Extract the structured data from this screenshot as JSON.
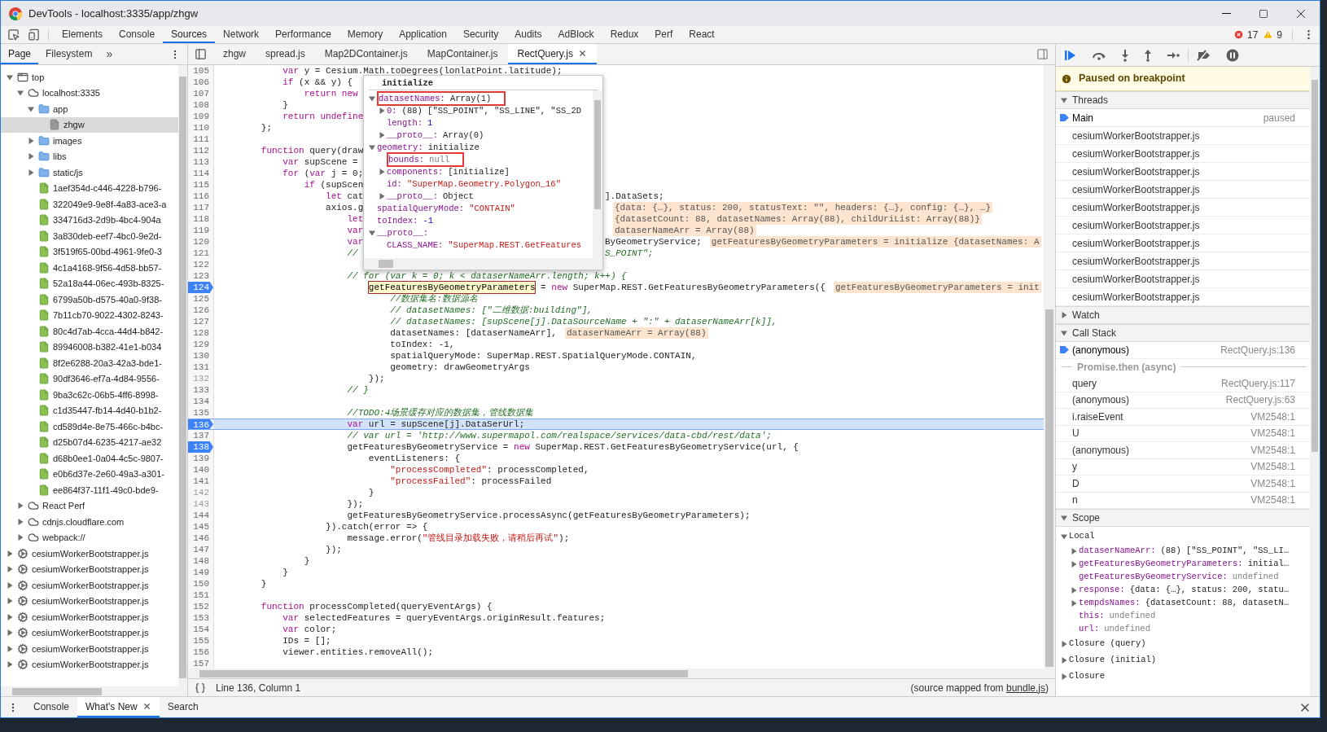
{
  "window": {
    "title": "DevTools - localhost:3335/app/zhgw"
  },
  "main_tabs": [
    {
      "label": "Elements",
      "selected": false
    },
    {
      "label": "Console",
      "selected": false
    },
    {
      "label": "Sources",
      "selected": true
    },
    {
      "label": "Network",
      "selected": false
    },
    {
      "label": "Performance",
      "selected": false
    },
    {
      "label": "Memory",
      "selected": false
    },
    {
      "label": "Application",
      "selected": false
    },
    {
      "label": "Security",
      "selected": false
    },
    {
      "label": "Audits",
      "selected": false
    },
    {
      "label": "AdBlock",
      "selected": false
    },
    {
      "label": "Redux",
      "selected": false
    },
    {
      "label": "Perf",
      "selected": false
    },
    {
      "label": "React",
      "selected": false
    }
  ],
  "issues": {
    "errors": "17",
    "warnings": "9"
  },
  "sidebar": {
    "tabs": [
      {
        "label": "Page",
        "selected": true
      },
      {
        "label": "Filesystem",
        "selected": false
      }
    ],
    "more": "»",
    "tree": [
      {
        "label": "top",
        "kind": "frame",
        "expanded": true,
        "selected": false,
        "children": [
          {
            "label": "localhost:3335",
            "kind": "domain",
            "expanded": true,
            "selected": false,
            "children": [
              {
                "label": "app",
                "kind": "folder",
                "expanded": true,
                "selected": false,
                "children": [
                  {
                    "label": "zhgw",
                    "kind": "file",
                    "selected": true
                  }
                ]
              },
              {
                "label": "images",
                "kind": "folder",
                "expanded": false,
                "selected": false
              },
              {
                "label": "libs",
                "kind": "folder",
                "expanded": false,
                "selected": false
              },
              {
                "label": "static/js",
                "kind": "folder",
                "expanded": false,
                "selected": false
              },
              {
                "label": "1aef354d-c446-4228-b796-",
                "kind": "script",
                "selected": false
              },
              {
                "label": "322049e9-9e8f-4a83-ace3-a",
                "kind": "script",
                "selected": false
              },
              {
                "label": "334716d3-2d9b-4bc4-904a",
                "kind": "script",
                "selected": false
              },
              {
                "label": "3a830deb-eef7-4bc0-9e2d-",
                "kind": "script",
                "selected": false
              },
              {
                "label": "3f519f65-00bd-4961-9fe0-3",
                "kind": "script",
                "selected": false
              },
              {
                "label": "4c1a4168-9f56-4d58-bb57-",
                "kind": "script",
                "selected": false
              },
              {
                "label": "52a18a44-06ec-493b-8325-",
                "kind": "script",
                "selected": false
              },
              {
                "label": "6799a50b-d575-40a0-9f38-",
                "kind": "script",
                "selected": false
              },
              {
                "label": "7b11cb70-9022-4302-8243-",
                "kind": "script",
                "selected": false
              },
              {
                "label": "80c4d7ab-4cca-44d4-b842-",
                "kind": "script",
                "selected": false
              },
              {
                "label": "89946008-b382-41e1-b034",
                "kind": "script",
                "selected": false
              },
              {
                "label": "8f2e6288-20a3-42a3-bde1-",
                "kind": "script",
                "selected": false
              },
              {
                "label": "90df3646-ef7a-4d84-9556-",
                "kind": "script",
                "selected": false
              },
              {
                "label": "9ba3c62c-06b5-4ff6-8998-",
                "kind": "script",
                "selected": false
              },
              {
                "label": "c1d35447-fb14-4d40-b1b2-",
                "kind": "script",
                "selected": false
              },
              {
                "label": "cd589d4e-8e75-466c-b4bc-",
                "kind": "script",
                "selected": false
              },
              {
                "label": "d25b07d4-6235-4217-ae32",
                "kind": "script",
                "selected": false
              },
              {
                "label": "d68b0ee1-0a04-4c5c-9807-",
                "kind": "script",
                "selected": false
              },
              {
                "label": "e0b6d37e-2e60-49a3-a301-",
                "kind": "script",
                "selected": false
              },
              {
                "label": "ee864f37-11f1-49c0-bde9-",
                "kind": "script",
                "selected": false
              }
            ]
          },
          {
            "label": "React Perf",
            "kind": "domain",
            "expanded": false,
            "selected": false
          },
          {
            "label": "cdnjs.cloudflare.com",
            "kind": "domain",
            "expanded": false,
            "selected": false
          },
          {
            "label": "webpack://",
            "kind": "domain",
            "expanded": false,
            "selected": false
          }
        ]
      },
      {
        "label": "cesiumWorkerBootstrapper.js",
        "kind": "worker",
        "expanded": false,
        "selected": false
      },
      {
        "label": "cesiumWorkerBootstrapper.js",
        "kind": "worker",
        "expanded": false,
        "selected": false
      },
      {
        "label": "cesiumWorkerBootstrapper.js",
        "kind": "worker",
        "expanded": false,
        "selected": false
      },
      {
        "label": "cesiumWorkerBootstrapper.js",
        "kind": "worker",
        "expanded": false,
        "selected": false
      },
      {
        "label": "cesiumWorkerBootstrapper.js",
        "kind": "worker",
        "expanded": false,
        "selected": false
      },
      {
        "label": "cesiumWorkerBootstrapper.js",
        "kind": "worker",
        "expanded": false,
        "selected": false
      },
      {
        "label": "cesiumWorkerBootstrapper.js",
        "kind": "worker",
        "expanded": false,
        "selected": false
      },
      {
        "label": "cesiumWorkerBootstrapper.js",
        "kind": "worker",
        "expanded": false,
        "selected": false
      }
    ]
  },
  "editor_tabs": [
    {
      "label": "zhgw",
      "selected": false
    },
    {
      "label": "spread.js",
      "selected": false
    },
    {
      "label": "Map2DContainer.js",
      "selected": false
    },
    {
      "label": "MapContainer.js",
      "selected": false
    },
    {
      "label": "RectQuery.js",
      "selected": true
    }
  ],
  "code": {
    "lines": [
      {
        "n": "105",
        "breakpoint": false,
        "current": false,
        "breakable": true,
        "code": [
          {
            "text": "            var",
            "kind": "kw"
          },
          {
            "text": " y = Cesium.Math.toDegrees(lonlatPoint.latitude);",
            "kind": "plain"
          }
        ]
      },
      {
        "n": "106",
        "breakpoint": false,
        "current": false,
        "breakable": true,
        "code": [
          {
            "text": "            if",
            "kind": "kw"
          },
          {
            "text": " (x && y) {",
            "kind": "plain"
          }
        ]
      },
      {
        "n": "107",
        "breakpoint": false,
        "current": false,
        "breakable": true,
        "code": [
          {
            "text": "                return new",
            "kind": "kw"
          }
        ]
      },
      {
        "n": "108",
        "breakpoint": false,
        "current": false,
        "breakable": true,
        "code": [
          {
            "text": "            }",
            "kind": "plain"
          }
        ]
      },
      {
        "n": "109",
        "breakpoint": false,
        "current": false,
        "breakable": true,
        "code": [
          {
            "text": "            return undefine",
            "kind": "kw"
          }
        ]
      },
      {
        "n": "110",
        "breakpoint": false,
        "current": false,
        "breakable": true,
        "code": [
          {
            "text": "        };",
            "kind": "plain"
          }
        ]
      },
      {
        "n": "111",
        "breakpoint": false,
        "current": false,
        "breakable": true
      },
      {
        "n": "112",
        "breakpoint": false,
        "current": false,
        "breakable": true,
        "code": [
          {
            "text": "        function",
            "kind": "kw"
          },
          {
            "text": " query(draw",
            "kind": "plain"
          }
        ]
      },
      {
        "n": "113",
        "breakpoint": false,
        "current": false,
        "breakable": true,
        "code": [
          {
            "text": "            var",
            "kind": "kw"
          },
          {
            "text": " supScene =",
            "kind": "plain"
          }
        ]
      },
      {
        "n": "114",
        "breakpoint": false,
        "current": false,
        "breakable": true,
        "code": [
          {
            "text": "            for",
            "kind": "kw"
          },
          {
            "text": " (",
            "kind": "plain"
          },
          {
            "text": "var",
            "kind": "kw"
          },
          {
            "text": " j = 0;",
            "kind": "plain"
          }
        ]
      },
      {
        "n": "115",
        "breakpoint": false,
        "current": false,
        "breakable": true,
        "code": [
          {
            "text": "                if",
            "kind": "kw"
          },
          {
            "text": " (supScen",
            "kind": "plain"
          }
        ]
      },
      {
        "n": "116",
        "breakpoint": false,
        "current": false,
        "breakable": true,
        "code": [
          {
            "text": "                    let",
            "kind": "kw"
          },
          {
            "text": " cat",
            "kind": "plain"
          }
        ],
        "after": [
          {
            "text": "].DataSets;",
            "kind": "plain"
          }
        ]
      },
      {
        "n": "117",
        "breakpoint": false,
        "current": false,
        "breakable": true,
        "code": [
          {
            "text": "                    axios.g",
            "kind": "plain"
          }
        ],
        "after": [
          {
            "text": "{data: {…}, status: 200, statusText: \"\", headers: {…}, config: {…}, …}",
            "kind": "note"
          }
        ]
      },
      {
        "n": "118",
        "breakpoint": false,
        "current": false,
        "breakable": true,
        "code": [
          {
            "text": "                        let",
            "kind": "kw"
          }
        ],
        "after": [
          {
            "text": "{datasetCount: 88, datasetNames: Array(88), childUriList: Array(88)}",
            "kind": "note"
          }
        ]
      },
      {
        "n": "119",
        "breakpoint": false,
        "current": false,
        "breakable": true,
        "code": [
          {
            "text": "                        var",
            "kind": "kw"
          }
        ],
        "after": [
          {
            "text": "dataserNameArr = Array(88)",
            "kind": "note"
          }
        ]
      },
      {
        "n": "120",
        "breakpoint": false,
        "current": false,
        "breakable": true,
        "code": [
          {
            "text": "                        var",
            "kind": "kw"
          }
        ],
        "after": [
          {
            "text": "ByGeometryService;",
            "kind": "plain"
          },
          {
            "text": "getFeaturesByGeometryParameters = initialize {datasetNames: A",
            "kind": "note"
          }
        ]
      },
      {
        "n": "121",
        "breakpoint": false,
        "current": false,
        "breakable": true,
        "code": [
          {
            "text": "                        //",
            "kind": "cmt"
          }
        ],
        "after": [
          {
            "text": "S_POINT\";",
            "kind": "cmt"
          }
        ]
      },
      {
        "n": "122",
        "breakpoint": false,
        "current": false,
        "breakable": true
      },
      {
        "n": "123",
        "breakpoint": false,
        "current": false,
        "breakable": true,
        "code": [
          {
            "text": "                        // for (var k = 0; k < dataserNameArr.length; k++) {",
            "kind": "cmt"
          }
        ]
      },
      {
        "n": "124",
        "breakpoint": true,
        "current": false,
        "breakable": true,
        "code": [
          {
            "text": "                            getFeaturesByGeometryParameters",
            "kind": "hover"
          },
          {
            "text": " = ",
            "kind": "plain"
          },
          {
            "text": "new",
            "kind": "kw"
          },
          {
            "text": " SuperMap.REST.GetFeaturesByGeometryParameters({",
            "kind": "plain"
          },
          {
            "text": "getFeaturesByGeometryParameters = init",
            "kind": "note"
          }
        ]
      },
      {
        "n": "125",
        "breakpoint": false,
        "current": false,
        "breakable": true,
        "code": [
          {
            "text": "                                //数据集名:数据源名",
            "kind": "cmt"
          }
        ]
      },
      {
        "n": "126",
        "breakpoint": false,
        "current": false,
        "breakable": true,
        "code": [
          {
            "text": "                                // datasetNames: [\"二维数据:building\"],",
            "kind": "cmt"
          }
        ]
      },
      {
        "n": "127",
        "breakpoint": false,
        "current": false,
        "breakable": true,
        "code": [
          {
            "text": "                                // datasetNames: [supScene[j].DataSourceName + \":\" + dataserNameArr[k]],",
            "kind": "cmt"
          }
        ]
      },
      {
        "n": "128",
        "breakpoint": false,
        "current": false,
        "breakable": true,
        "code": [
          {
            "text": "                                datasetNames: [dataserNameArr],",
            "kind": "plain"
          },
          {
            "text": "dataserNameArr = Array(88)",
            "kind": "note"
          }
        ]
      },
      {
        "n": "129",
        "breakpoint": false,
        "current": false,
        "breakable": true,
        "code": [
          {
            "text": "                                toIndex: -1,",
            "kind": "plain"
          }
        ]
      },
      {
        "n": "130",
        "breakpoint": false,
        "current": false,
        "breakable": true,
        "code": [
          {
            "text": "                                spatialQueryMode: SuperMap.REST.SpatialQueryMode.CONTAIN,",
            "kind": "plain"
          }
        ]
      },
      {
        "n": "131",
        "breakpoint": false,
        "current": false,
        "breakable": true,
        "code": [
          {
            "text": "                                geometry: drawGeometryArgs",
            "kind": "plain"
          }
        ]
      },
      {
        "n": "132",
        "breakpoint": false,
        "current": false,
        "breakable": false,
        "code": [
          {
            "text": "                            });",
            "kind": "plain"
          }
        ]
      },
      {
        "n": "133",
        "breakpoint": false,
        "current": false,
        "breakable": true,
        "code": [
          {
            "text": "                        // }",
            "kind": "cmt"
          }
        ]
      },
      {
        "n": "134",
        "breakpoint": false,
        "current": false,
        "breakable": true
      },
      {
        "n": "135",
        "breakpoint": false,
        "current": false,
        "breakable": true,
        "code": [
          {
            "text": "                        //TODO:4场景缓存对应的数据集，管线数据集",
            "kind": "cmt"
          }
        ]
      },
      {
        "n": "136",
        "breakpoint": true,
        "current": true,
        "breakable": true,
        "code": [
          {
            "text": "                        var",
            "kind": "kw"
          },
          {
            "text": " url = supScene[j].DataSerUrl;",
            "kind": "plain"
          }
        ]
      },
      {
        "n": "137",
        "breakpoint": false,
        "current": false,
        "breakable": true,
        "code": [
          {
            "text": "                        // var url = 'http://www.supermapol.com/realspace/services/data-cbd/rest/data';",
            "kind": "cmt"
          }
        ]
      },
      {
        "n": "138",
        "breakpoint": true,
        "current": false,
        "breakable": true,
        "code": [
          {
            "text": "                        getFeaturesByGeometryService = ",
            "kind": "plain"
          },
          {
            "text": "new",
            "kind": "kw"
          },
          {
            "text": " SuperMap.REST.GetFeaturesByGeometryService(url, {",
            "kind": "plain"
          }
        ]
      },
      {
        "n": "139",
        "breakpoint": false,
        "current": false,
        "breakable": true,
        "code": [
          {
            "text": "                            eventListeners: {",
            "kind": "plain"
          }
        ]
      },
      {
        "n": "140",
        "breakpoint": false,
        "current": false,
        "breakable": true,
        "code": [
          {
            "text": "                                \"processCompleted\"",
            "kind": "str"
          },
          {
            "text": ": processCompleted,",
            "kind": "plain"
          }
        ]
      },
      {
        "n": "141",
        "breakpoint": false,
        "current": false,
        "breakable": true,
        "code": [
          {
            "text": "                                \"processFailed\"",
            "kind": "str"
          },
          {
            "text": ": processFailed",
            "kind": "plain"
          }
        ]
      },
      {
        "n": "142",
        "breakpoint": false,
        "current": false,
        "breakable": false,
        "code": [
          {
            "text": "                            }",
            "kind": "plain"
          }
        ]
      },
      {
        "n": "143",
        "breakpoint": false,
        "current": false,
        "breakable": false,
        "code": [
          {
            "text": "                        });",
            "kind": "plain"
          }
        ]
      },
      {
        "n": "144",
        "breakpoint": false,
        "current": false,
        "breakable": true,
        "code": [
          {
            "text": "                        getFeaturesByGeometryService.processAsync(getFeaturesByGeometryParameters);",
            "kind": "plain"
          }
        ]
      },
      {
        "n": "145",
        "breakpoint": false,
        "current": false,
        "breakable": true,
        "code": [
          {
            "text": "                    }).catch(error => {",
            "kind": "plain"
          }
        ]
      },
      {
        "n": "146",
        "breakpoint": false,
        "current": false,
        "breakable": true,
        "code": [
          {
            "text": "                        message.error(",
            "kind": "plain"
          },
          {
            "text": "\"管线目录加载失败，请稍后再试\"",
            "kind": "str"
          },
          {
            "text": ");",
            "kind": "plain"
          }
        ]
      },
      {
        "n": "147",
        "breakpoint": false,
        "current": false,
        "breakable": true,
        "code": [
          {
            "text": "                    });",
            "kind": "plain"
          }
        ]
      },
      {
        "n": "148",
        "breakpoint": false,
        "current": false,
        "breakable": true,
        "code": [
          {
            "text": "                }",
            "kind": "plain"
          }
        ]
      },
      {
        "n": "149",
        "breakpoint": false,
        "current": false,
        "breakable": true,
        "code": [
          {
            "text": "            }",
            "kind": "plain"
          }
        ]
      },
      {
        "n": "150",
        "breakpoint": false,
        "current": false,
        "breakable": true,
        "code": [
          {
            "text": "        }",
            "kind": "plain"
          }
        ]
      },
      {
        "n": "151",
        "breakpoint": false,
        "current": false,
        "breakable": true
      },
      {
        "n": "152",
        "breakpoint": false,
        "current": false,
        "breakable": true,
        "code": [
          {
            "text": "        function",
            "kind": "kw"
          },
          {
            "text": " processCompleted(queryEventArgs) {",
            "kind": "plain"
          }
        ]
      },
      {
        "n": "153",
        "breakpoint": false,
        "current": false,
        "breakable": true,
        "code": [
          {
            "text": "            var",
            "kind": "kw"
          },
          {
            "text": " selectedFeatures = queryEventArgs.originResult.features;",
            "kind": "plain"
          }
        ]
      },
      {
        "n": "154",
        "breakpoint": false,
        "current": false,
        "breakable": true,
        "code": [
          {
            "text": "            var",
            "kind": "kw"
          },
          {
            "text": " color;",
            "kind": "plain"
          }
        ]
      },
      {
        "n": "155",
        "breakpoint": false,
        "current": false,
        "breakable": true,
        "code": [
          {
            "text": "            IDs = [];",
            "kind": "plain"
          }
        ]
      },
      {
        "n": "156",
        "breakpoint": false,
        "current": false,
        "breakable": true,
        "code": [
          {
            "text": "            viewer.entities.removeAll();",
            "kind": "plain"
          }
        ]
      },
      {
        "n": "157",
        "breakpoint": false,
        "current": false,
        "breakable": true
      }
    ],
    "popover": {
      "title": "initialize",
      "entries": [
        {
          "key": "datasetNames:",
          "value": "Array(1)",
          "kind": "obj",
          "expanded": true,
          "boxed": true,
          "children": [
            {
              "key": "0:",
              "value": "(88) [\"SS_POINT\", \"SS_LINE\", \"SS_2D",
              "kind": "arr",
              "expanded": false,
              "boxed": false
            },
            {
              "key": "length:",
              "value": "1",
              "kind": "num",
              "boxed": false
            },
            {
              "key": "__proto__:",
              "value": "Array(0)",
              "kind": "obj",
              "expanded": false,
              "boxed": false
            }
          ]
        },
        {
          "key": "geometry:",
          "value": "initialize",
          "kind": "obj",
          "expanded": true,
          "boxed": false,
          "children": [
            {
              "key": "bounds:",
              "value": "null",
              "kind": "null",
              "boxed": true
            },
            {
              "key": "components:",
              "value": "[initialize]",
              "kind": "obj",
              "expanded": false,
              "boxed": false
            },
            {
              "key": "id:",
              "value": "\"SuperMap.Geometry.Polygon_16\"",
              "kind": "str",
              "boxed": false
            },
            {
              "key": "__proto__:",
              "value": "Object",
              "kind": "obj",
              "expanded": false,
              "boxed": false
            }
          ]
        },
        {
          "key": "spatialQueryMode:",
          "value": "\"CONTAIN\"",
          "kind": "str",
          "boxed": false
        },
        {
          "key": "toIndex:",
          "value": "-1",
          "kind": "num",
          "boxed": false
        },
        {
          "key": "__proto__:",
          "expanded": true,
          "boxed": false,
          "children": [
            {
              "key": "CLASS_NAME:",
              "value": "\"SuperMap.REST.GetFeatures",
              "kind": "str",
              "boxed": false
            }
          ]
        }
      ]
    }
  },
  "status_bar": {
    "position": "Line 136, Column 1",
    "source_map": {
      "prefix": "(source mapped from ",
      "link": "bundle.js",
      "suffix": ")"
    }
  },
  "debugger": {
    "banner": "Paused on breakpoint",
    "threads": {
      "title": "Threads",
      "expanded": true,
      "items": [
        {
          "name": "Main",
          "status": "paused",
          "current": true
        },
        {
          "name": "cesiumWorkerBootstrapper.js",
          "current": false
        },
        {
          "name": "cesiumWorkerBootstrapper.js",
          "current": false
        },
        {
          "name": "cesiumWorkerBootstrapper.js",
          "current": false
        },
        {
          "name": "cesiumWorkerBootstrapper.js",
          "current": false
        },
        {
          "name": "cesiumWorkerBootstrapper.js",
          "current": false
        },
        {
          "name": "cesiumWorkerBootstrapper.js",
          "current": false
        },
        {
          "name": "cesiumWorkerBootstrapper.js",
          "current": false
        },
        {
          "name": "cesiumWorkerBootstrapper.js",
          "current": false
        },
        {
          "name": "cesiumWorkerBootstrapper.js",
          "current": false
        },
        {
          "name": "cesiumWorkerBootstrapper.js",
          "current": false
        }
      ]
    },
    "watch": {
      "title": "Watch",
      "expanded": false
    },
    "call_stack": {
      "title": "Call Stack",
      "expanded": true,
      "items": [
        {
          "kind": "frame",
          "name": "(anonymous)",
          "location": "RectQuery.js:136",
          "current": true
        },
        {
          "kind": "async",
          "label": "Promise.then (async)"
        },
        {
          "kind": "frame",
          "name": "query",
          "location": "RectQuery.js:117",
          "current": false
        },
        {
          "kind": "frame",
          "name": "(anonymous)",
          "location": "RectQuery.js:63",
          "current": false
        },
        {
          "kind": "frame",
          "name": "i.raiseEvent",
          "location": "VM2548:1",
          "current": false
        },
        {
          "kind": "frame",
          "name": "U",
          "location": "VM2548:1",
          "current": false
        },
        {
          "kind": "frame",
          "name": "(anonymous)",
          "location": "VM2548:1",
          "current": false
        },
        {
          "kind": "frame",
          "name": "y",
          "location": "VM2548:1",
          "current": false
        },
        {
          "kind": "frame",
          "name": "D",
          "location": "VM2548:1",
          "current": false
        },
        {
          "kind": "frame",
          "name": "n",
          "location": "VM2548:1",
          "current": false
        }
      ]
    },
    "scope": {
      "title": "Scope",
      "expanded": true,
      "items": [
        {
          "key": "Local",
          "expanded": true,
          "children": [
            {
              "key": "dataserNameArr:",
              "value": "(88) [\"SS_POINT\", \"SS_LI…",
              "kind": "arr",
              "expanded": false
            },
            {
              "key": "getFeaturesByGeometryParameters:",
              "value": "initial…",
              "kind": "obj",
              "expanded": false
            },
            {
              "key": "getFeaturesByGeometryService:",
              "value": "undefined",
              "kind": "null"
            },
            {
              "key": "response:",
              "value": "{data: {…}, status: 200, statu…",
              "kind": "obj",
              "expanded": false
            },
            {
              "key": "tempdsNames:",
              "value": "{datasetCount: 88, datasetN…",
              "kind": "obj",
              "expanded": false
            },
            {
              "key": "this:",
              "value": "undefined",
              "kind": "null"
            },
            {
              "key": "url:",
              "value": "undefined",
              "kind": "null"
            }
          ]
        },
        {
          "key": "Closure (query)",
          "expanded": false
        },
        {
          "key": "Closure (initial)",
          "expanded": false
        },
        {
          "key": "Closure",
          "expanded": false
        }
      ]
    }
  },
  "drawer": {
    "tabs": [
      {
        "label": "Console",
        "selected": false
      },
      {
        "label": "What's New",
        "selected": true
      },
      {
        "label": "Search",
        "selected": false
      }
    ]
  }
}
